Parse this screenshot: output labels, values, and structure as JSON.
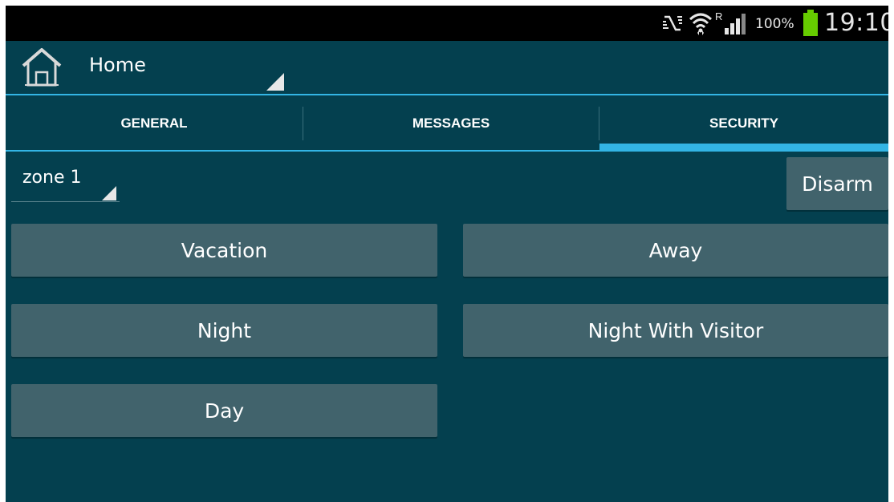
{
  "status_bar": {
    "battery_percent": "100%",
    "time": "19:10",
    "signal_roaming": "R",
    "icons": [
      "nfc-icon",
      "wifi-icon",
      "signal-icon",
      "battery-icon"
    ]
  },
  "action_bar": {
    "title": "Home",
    "icon": "home-icon"
  },
  "tabs": [
    {
      "label": "GENERAL",
      "selected": false
    },
    {
      "label": "MESSAGES",
      "selected": false
    },
    {
      "label": "SECURITY",
      "selected": true
    }
  ],
  "zone": {
    "selected": "zone 1"
  },
  "buttons": {
    "disarm": "Disarm",
    "vacation": "Vacation",
    "away": "Away",
    "night": "Night",
    "night_with_visitor": "Night With Visitor",
    "day": "Day"
  },
  "colors": {
    "background": "#04404f",
    "accent": "#33b5e5",
    "button": "#41636c",
    "status_bar": "#000000",
    "battery": "#66cc00"
  }
}
